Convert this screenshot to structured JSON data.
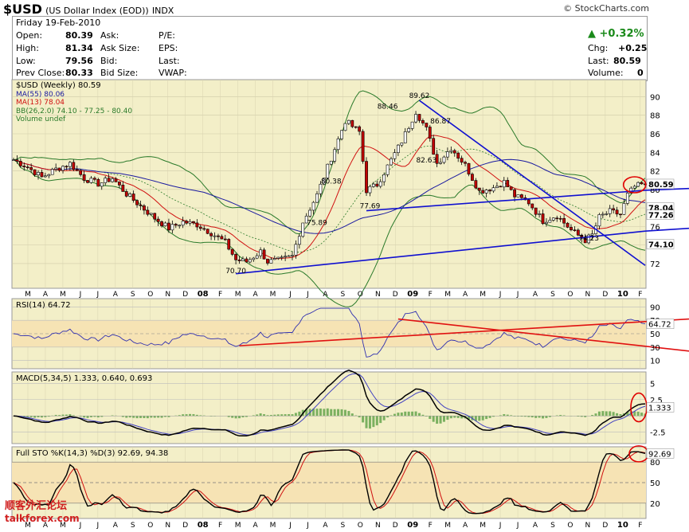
{
  "header": {
    "symbol": "$USD",
    "name": "(US Dollar Index (EOD))",
    "exchange": "INDX",
    "brand": "© StockCharts.com"
  },
  "quote": {
    "date": "Friday   19-Feb-2010",
    "open_l": "Open:",
    "open": "80.39",
    "high_l": "High:",
    "high": "81.34",
    "low_l": "Low:",
    "low": "79.56",
    "prev_l": "Prev Close:",
    "prev": "80.33",
    "ask_l": "Ask:",
    "asksize_l": "Ask Size:",
    "bid_l": "Bid:",
    "bidsize_l": "Bid Size:",
    "pe_l": "P/E:",
    "eps_l": "EPS:",
    "last_l2": "Last:",
    "vwap_l": "VWAP:",
    "pct": "+0.32%",
    "chg_l": "Chg:",
    "chg": "+0.25",
    "last_l": "Last:",
    "last": "80.59",
    "vol_l": "Volume:",
    "vol": "0"
  },
  "legend": {
    "main": "$USD (Weekly) 80.59",
    "ma55": "MA(55) 80.06",
    "ma13": "MA(13) 78.04",
    "bb": "BB(26,2.0) 74.10 - 77.25 - 80.40",
    "vol": "Volume undef",
    "rsi": "RSI(14) 64.72",
    "macd": "MACD(5,34,5) 1.333, 0.640, 0.693",
    "sto": "Full STO %K(14,3) %D(3) 92.69, 94.38"
  },
  "watermark": {
    "cn": "顺客外汇论坛",
    "site": "talkforex.com"
  },
  "colors": {
    "price": "#000000",
    "ma55": "#1a1aa0",
    "ma13": "#d01010",
    "bb": "#2a7a2a",
    "trend": "#1010d0",
    "rsi_trend": "#e01010",
    "rsi": "#3030b0",
    "panel": "#f3efc8",
    "macd_hist": "#7bb060"
  },
  "chart_data": [
    {
      "type": "candlestick",
      "title": "$USD (Weekly) 80.59",
      "ylim": [
        69.5,
        91.5
      ],
      "yticks": [
        72,
        74,
        76,
        78,
        80,
        82,
        84,
        86,
        88,
        90
      ],
      "xticks": [
        "M",
        "A",
        "M",
        "J",
        "J",
        "A",
        "S",
        "O",
        "N",
        "D",
        "08",
        "F",
        "M",
        "A",
        "M",
        "J",
        "J",
        "A",
        "S",
        "O",
        "N",
        "D",
        "09",
        "F",
        "M",
        "A",
        "M",
        "J",
        "J",
        "A",
        "S",
        "O",
        "N",
        "D",
        "10",
        "F"
      ],
      "close_path": [
        [
          0,
          83.2
        ],
        [
          4,
          82.4
        ],
        [
          8,
          81.3
        ],
        [
          12,
          82.2
        ],
        [
          16,
          82.8
        ],
        [
          20,
          81.2
        ],
        [
          24,
          80.6
        ],
        [
          28,
          81.2
        ],
        [
          32,
          79.5
        ],
        [
          36,
          78.2
        ],
        [
          40,
          76.9
        ],
        [
          44,
          75.8
        ],
        [
          48,
          76.5
        ],
        [
          52,
          76.2
        ],
        [
          56,
          75.3
        ],
        [
          60,
          74.3
        ],
        [
          63,
          72.4
        ],
        [
          66,
          72.2
        ],
        [
          70,
          73.3
        ],
        [
          72,
          72.2
        ],
        [
          76,
          72.4
        ],
        [
          79,
          72.8
        ],
        [
          82,
          76.5
        ],
        [
          86,
          79.4
        ],
        [
          90,
          83.4
        ],
        [
          94,
          87.4
        ],
        [
          98,
          86.2
        ],
        [
          100,
          79.9
        ],
        [
          103,
          80.5
        ],
        [
          106,
          82.5
        ],
        [
          110,
          85.2
        ],
        [
          114,
          88.4
        ],
        [
          117,
          86.5
        ],
        [
          120,
          82.8
        ],
        [
          124,
          84.5
        ],
        [
          128,
          82.6
        ],
        [
          132,
          79.8
        ],
        [
          136,
          80.2
        ],
        [
          139,
          80.8
        ],
        [
          142,
          79.3
        ],
        [
          146,
          78.6
        ],
        [
          150,
          76.6
        ],
        [
          154,
          77.2
        ],
        [
          158,
          75.6
        ],
        [
          162,
          74.5
        ],
        [
          164,
          75.1
        ],
        [
          166,
          77.0
        ],
        [
          169,
          77.6
        ],
        [
          172,
          77.3
        ],
        [
          174,
          79.4
        ],
        [
          176,
          80.3
        ],
        [
          179,
          80.6
        ]
      ],
      "annotations": [
        {
          "label": "88.46",
          "x": 106,
          "y": 88.46
        },
        {
          "label": "89.62",
          "x": 115,
          "y": 89.62
        },
        {
          "label": "86.87",
          "x": 121,
          "y": 86.87
        },
        {
          "label": "80.38",
          "x": 90,
          "y": 80.38
        },
        {
          "label": "75.89",
          "x": 86,
          "y": 75.89
        },
        {
          "label": "77.69",
          "x": 101,
          "y": 77.69
        },
        {
          "label": "82.63",
          "x": 117,
          "y": 82.63
        },
        {
          "label": "74.23",
          "x": 163,
          "y": 74.23
        },
        {
          "label": "70.70",
          "x": 63,
          "y": 70.7
        }
      ],
      "last": {
        "label": "80.59",
        "value": 80.59
      },
      "indicator_labels": [
        {
          "label": "78.04",
          "value": 78.04
        },
        {
          "label": "77.26",
          "value": 77.26
        },
        {
          "label": "74.10",
          "value": 74.1
        }
      ]
    },
    {
      "type": "line",
      "title": "RSI(14) 64.72",
      "ylim": [
        0,
        100
      ],
      "yticks": [
        10,
        30,
        50,
        70,
        90
      ],
      "last": {
        "label": "64.72",
        "value": 64.72
      }
    },
    {
      "type": "line",
      "title": "MACD(5,34,5) 1.333, 0.640, 0.693",
      "ylim": [
        -4,
        6.5
      ],
      "yticks": [
        -2.5,
        2.5,
        5.0
      ],
      "last": {
        "label": "1.333",
        "value": 1.333
      }
    },
    {
      "type": "line",
      "title": "Full STO %K(14,3) %D(3) 92.69, 94.38",
      "ylim": [
        0,
        100
      ],
      "yticks": [
        20,
        50,
        80
      ],
      "last": {
        "label": "92.69",
        "value": 92.69
      }
    }
  ]
}
